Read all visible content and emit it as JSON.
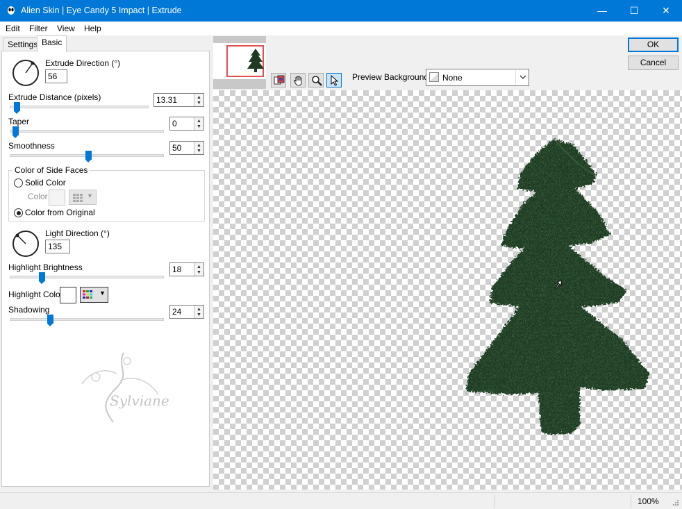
{
  "window": {
    "title": "Alien Skin | Eye Candy 5 Impact | Extrude",
    "minimize": "—",
    "maximize": "☐",
    "close": "✕"
  },
  "menu": [
    "Edit",
    "Filter",
    "View",
    "Help"
  ],
  "tabs": [
    "Settings",
    "Basic"
  ],
  "params": {
    "extrude_direction": {
      "label": "Extrude Direction (°)",
      "value": "56"
    },
    "extrude_distance": {
      "label": "Extrude Distance (pixels)",
      "value": "13.31",
      "fraction": 0.06
    },
    "taper": {
      "label": "Taper",
      "value": "0",
      "fraction": 0.0
    },
    "smoothness": {
      "label": "Smoothness",
      "value": "50",
      "fraction": 0.5
    },
    "side_faces": {
      "group_label": "Color of Side Faces",
      "solid_color": "Solid Color",
      "color_label": "Color",
      "from_original": "Color from Original",
      "selected": "from_original"
    },
    "light_direction": {
      "label": "Light Direction (°)",
      "value": "135"
    },
    "highlight_brightness": {
      "label": "Highlight Brightness",
      "value": "18",
      "fraction": 0.18
    },
    "highlight_color": {
      "label": "Highlight Color",
      "swatch": "#ffffff"
    },
    "shadowing": {
      "label": "Shadowing",
      "value": "24",
      "fraction": 0.24
    }
  },
  "watermark_text": "Sylviane",
  "preview": {
    "background_label": "Preview Background:",
    "background_value": "None"
  },
  "buttons": {
    "ok": "OK",
    "cancel": "Cancel"
  },
  "status": {
    "zoom": "100%"
  },
  "colors": {
    "accent": "#0078d7",
    "tree": "#1f3a22"
  }
}
